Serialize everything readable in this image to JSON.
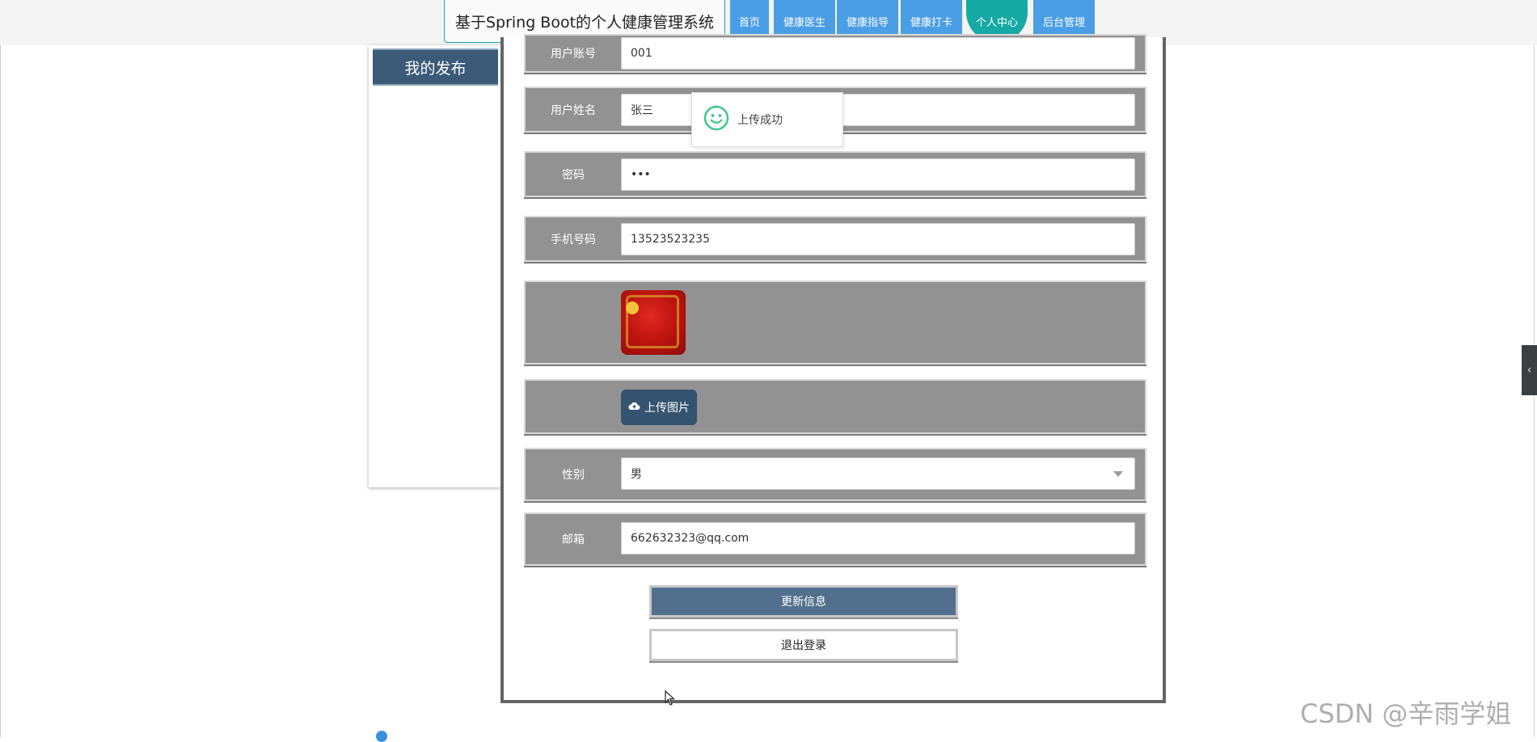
{
  "header": {
    "site_title": "基于Spring Boot的个人健康管理系统",
    "nav": [
      {
        "label": "首页"
      },
      {
        "label": "健康医生"
      },
      {
        "label": "健康指导"
      },
      {
        "label": "健康打卡"
      },
      {
        "label": "个人中心",
        "active": true
      },
      {
        "label": "后台管理"
      }
    ]
  },
  "sidebar": {
    "items": [
      {
        "label": "我的发布"
      }
    ]
  },
  "form": {
    "account": {
      "label": "用户账号",
      "value": "001"
    },
    "name": {
      "label": "用户姓名",
      "value": "张三"
    },
    "password": {
      "label": "密码",
      "value": "•••"
    },
    "phone": {
      "label": "手机号码",
      "value": "13523523235"
    },
    "avatar": {
      "icon": "avatar-image"
    },
    "upload": {
      "label": "上传图片",
      "icon": "cloud-upload-icon"
    },
    "gender": {
      "label": "性别",
      "value": "男"
    },
    "email": {
      "label": "邮箱",
      "value": "662632323@qq.com"
    },
    "update_button": "更新信息",
    "logout_button": "退出登录"
  },
  "toast": {
    "message": "上传成功",
    "icon": "smile-icon"
  },
  "watermark": "CSDN @辛雨学姐",
  "colors": {
    "nav_blue": "#4a9ee6",
    "nav_active": "#17a9a4",
    "sidebar_item": "#3a5a78",
    "row_bg": "#929292",
    "update_btn": "#52708e"
  }
}
